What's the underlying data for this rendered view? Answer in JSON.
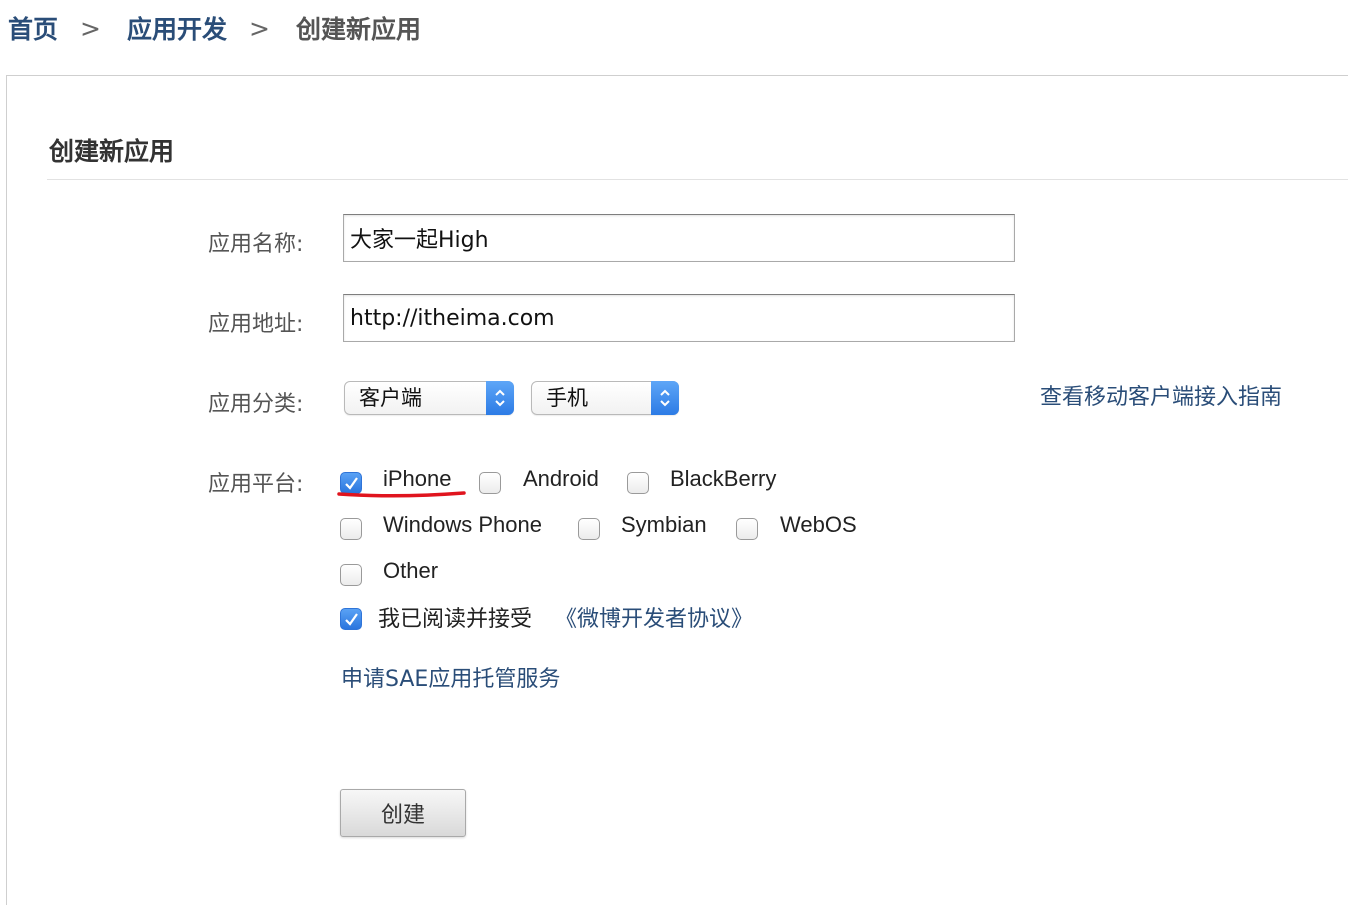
{
  "breadcrumb": {
    "home": "首页",
    "dev": "应用开发",
    "current": "创建新应用",
    "separator": ">"
  },
  "panel": {
    "title": "创建新应用"
  },
  "form": {
    "name_label": "应用名称:",
    "name_value": "大家一起High",
    "url_label": "应用地址:",
    "url_value": "http://itheima.com",
    "category_label": "应用分类:",
    "category_select_1": "客户端",
    "category_select_2": "手机",
    "guide_link": "查看移动客户端接入指南",
    "platform_label": "应用平台:",
    "platforms": [
      {
        "label": "iPhone",
        "checked": true
      },
      {
        "label": "Android",
        "checked": false
      },
      {
        "label": "BlackBerry",
        "checked": false
      },
      {
        "label": "Windows Phone",
        "checked": false
      },
      {
        "label": "Symbian",
        "checked": false
      },
      {
        "label": "WebOS",
        "checked": false
      },
      {
        "label": "Other",
        "checked": false
      }
    ],
    "agree_text": "我已阅读并接受",
    "agree_link": "《微博开发者协议》",
    "agree_checked": true,
    "sae_link": "申请SAE应用托管服务",
    "submit_label": "创建"
  },
  "colors": {
    "link": "#2a4d78",
    "checkbox_checked": "#2a75de",
    "annotation": "#e0141e"
  }
}
